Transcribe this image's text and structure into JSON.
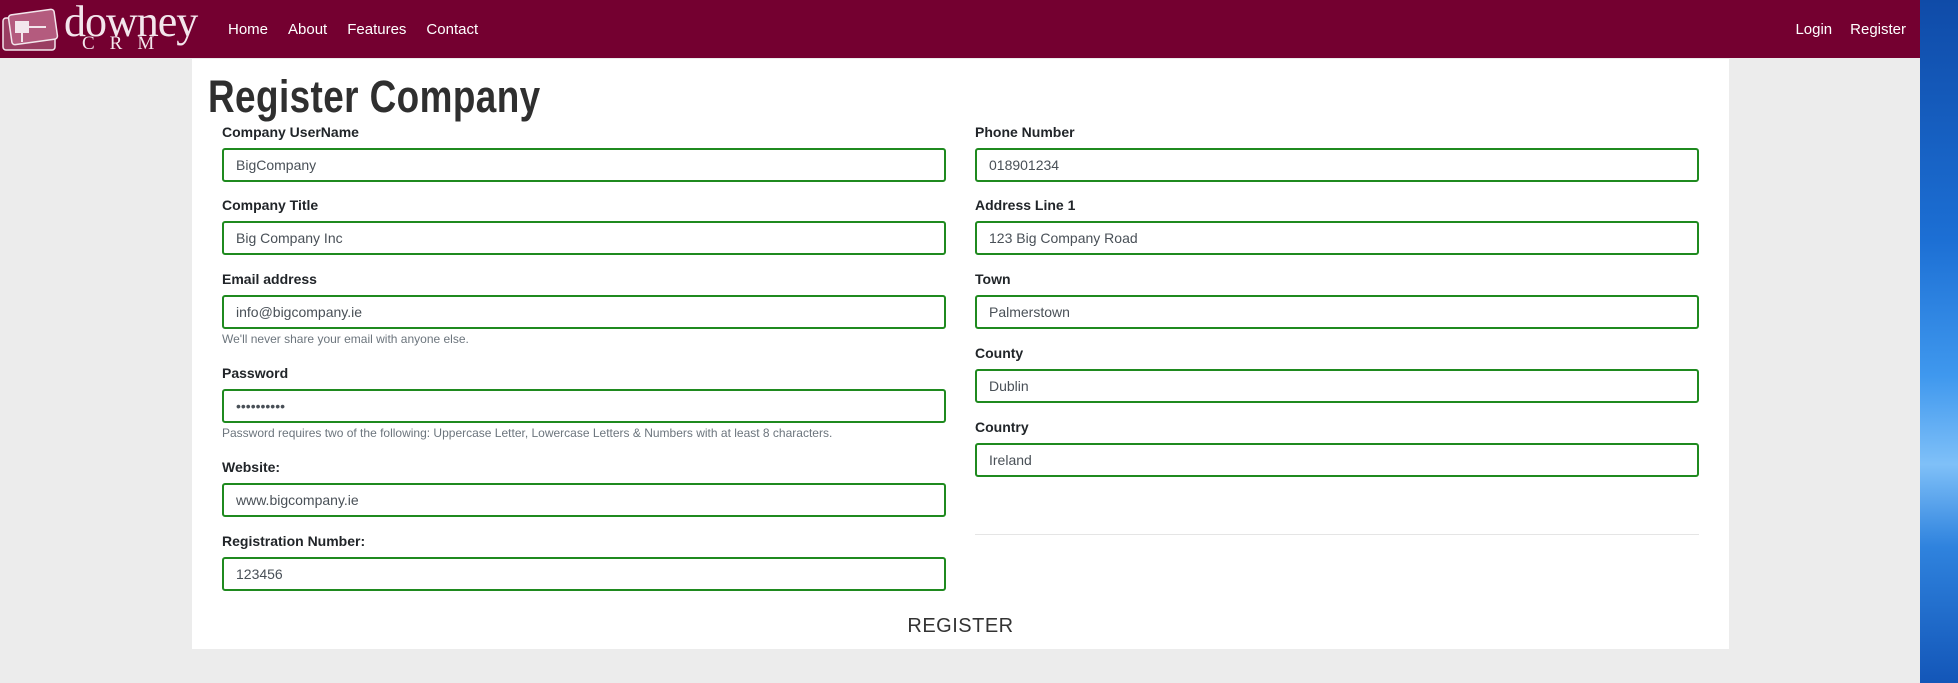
{
  "brand": {
    "name": "downey",
    "sub": "CRM"
  },
  "nav": {
    "left": [
      "Home",
      "About",
      "Features",
      "Contact"
    ],
    "right": [
      "Login",
      "Register"
    ]
  },
  "page": {
    "title": "Register Company"
  },
  "form": {
    "left": [
      {
        "label": "Company UserName",
        "value": "BigCompany"
      },
      {
        "label": "Company Title",
        "value": "Big Company Inc"
      },
      {
        "label": "Email address",
        "value": "info@bigcompany.ie",
        "help": "We'll never share your email with anyone else."
      },
      {
        "label": "Password",
        "value": "••••••••••",
        "help": "Password requires two of the following: Uppercase Letter, Lowercase Letters & Numbers with at least 8 characters."
      },
      {
        "label": "Website:",
        "value": "www.bigcompany.ie"
      },
      {
        "label": "Registration Number:",
        "value": "123456"
      }
    ],
    "right": [
      {
        "label": "Phone Number",
        "value": "018901234"
      },
      {
        "label": "Address Line 1",
        "value": "123 Big Company Road"
      },
      {
        "label": "Town",
        "value": "Palmerstown"
      },
      {
        "label": "County",
        "value": "Dublin"
      },
      {
        "label": "Country",
        "value": "Ireland"
      }
    ],
    "submit_label": "REGISTER"
  },
  "colors": {
    "navbar": "#740030",
    "input_border": "#1f8a1f",
    "background": "#ececec"
  }
}
